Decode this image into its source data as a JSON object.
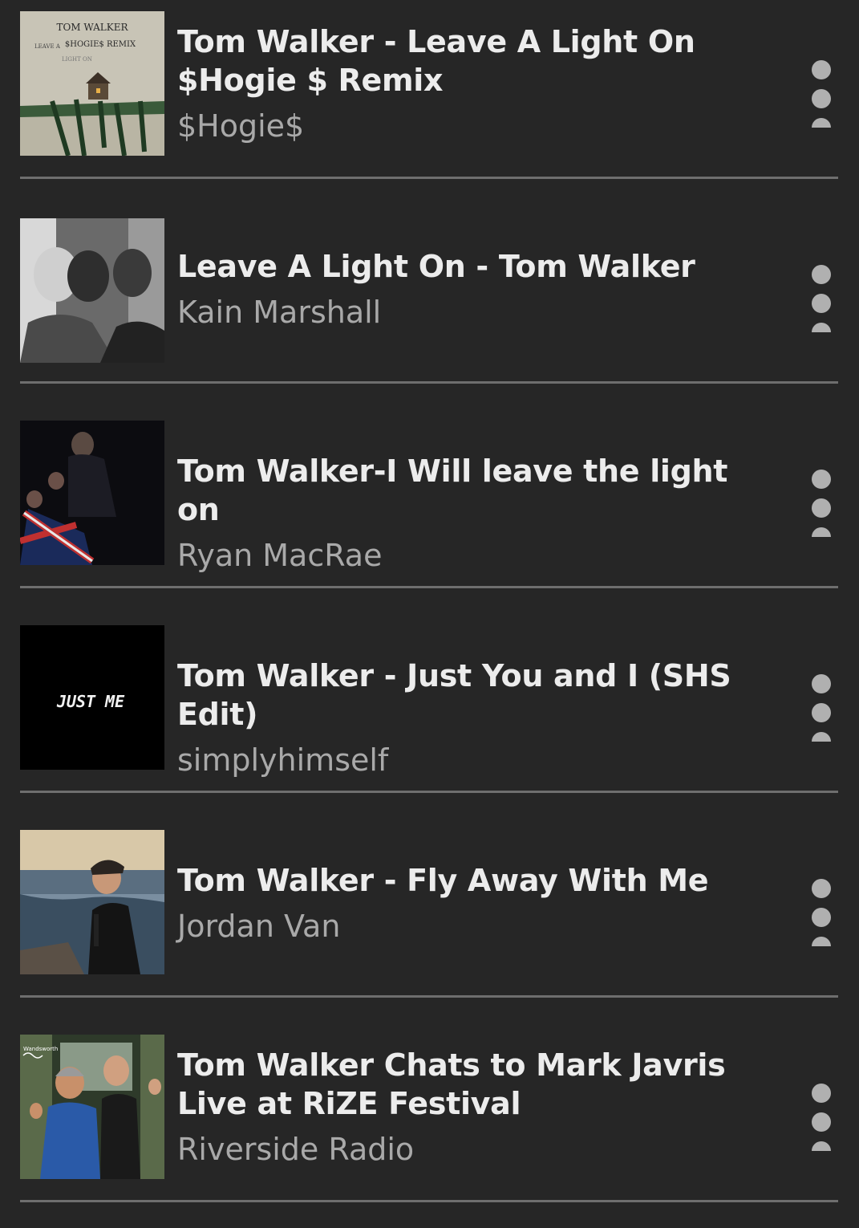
{
  "tracks": [
    {
      "title": "Tom Walker - Leave A Light On $Hogie $ Remix",
      "artist": "$Hogie$",
      "thumb_text": [
        "TOM WALKER",
        "LEAVE A",
        "$HOGIE$ REMIX",
        "LIGHT ON"
      ]
    },
    {
      "title": "Leave A Light On - Tom Walker",
      "artist": "Kain Marshall"
    },
    {
      "title": "Tom Walker-I Will leave the light on",
      "artist": "Ryan MacRae"
    },
    {
      "title": "Tom Walker - Just You and I (SHS Edit)",
      "artist": "simplyhimself",
      "thumb_text": [
        "JUST ME"
      ]
    },
    {
      "title": "Tom Walker - Fly Away With Me",
      "artist": "Jordan Van"
    },
    {
      "title": "Tom Walker Chats to Mark Javris Live at RiZE Festival",
      "artist": "Riverside Radio",
      "thumb_text": [
        "Wandsworth"
      ]
    }
  ],
  "icons": {
    "more": "more-vertical-icon"
  },
  "colors": {
    "background": "#262626",
    "title": "#ececec",
    "subtitle": "#a9a9a9",
    "divider": "#6e6e6e",
    "dots": "#b0b0b0"
  }
}
